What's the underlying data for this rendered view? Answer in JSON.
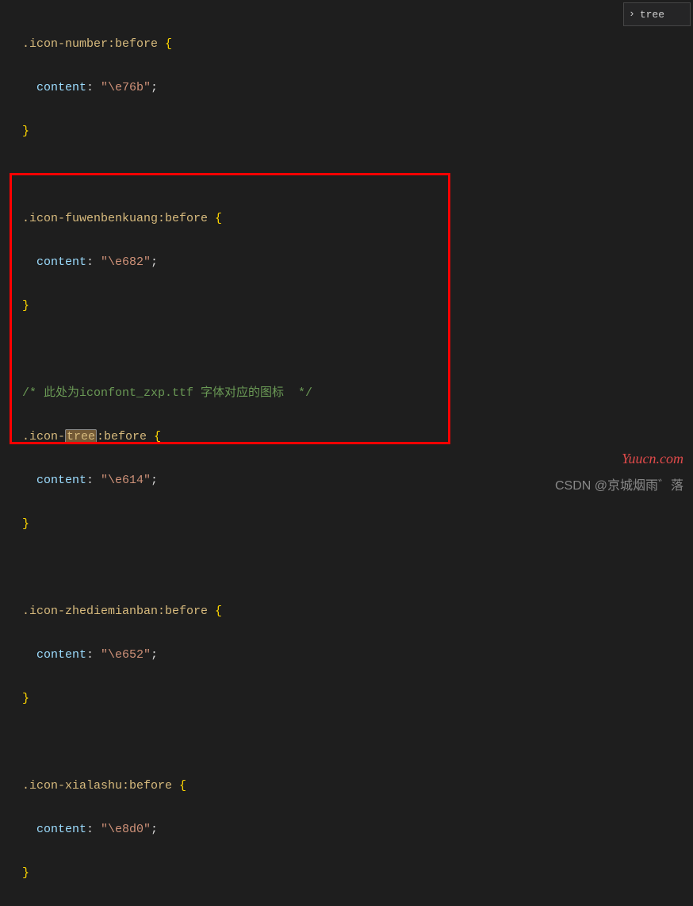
{
  "search": {
    "value": "tree"
  },
  "code": {
    "rule1": {
      "selector_prefix": ".icon-number",
      "selector_pseudo": ":before",
      "prop": "content",
      "value": "\"\\e76b\""
    },
    "rule2": {
      "selector_prefix": ".icon-fuwenbenkuang",
      "selector_pseudo": ":before",
      "prop": "content",
      "value": "\"\\e682\""
    },
    "comment": "/* 此处为iconfont_zxp.ttf 字体对应的图标  */",
    "rule3": {
      "selector_pre": ".icon-",
      "selector_hl": "tree",
      "selector_pseudo": ":before",
      "prop": "content",
      "value": "\"\\e614\""
    },
    "rule4": {
      "selector_prefix": ".icon-zhediemianban",
      "selector_pseudo": ":before",
      "prop": "content",
      "value": "\"\\e652\""
    },
    "rule5": {
      "selector_prefix": ".icon-xialashu",
      "selector_pseudo": ":before",
      "prop": "content",
      "value": "\"\\e8d0\""
    },
    "brace_open": " {",
    "brace_close": "}",
    "colon": ": ",
    "semi": ";"
  },
  "watermark": {
    "yuucn": "Yuucn.com",
    "csdn": "CSDN @京城烟雨゛落"
  }
}
